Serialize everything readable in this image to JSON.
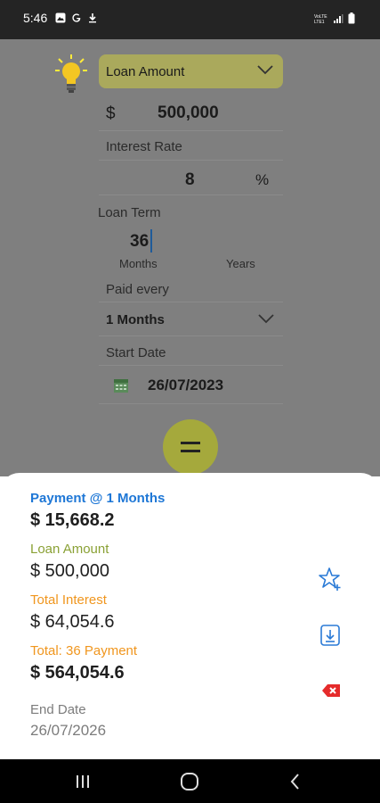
{
  "status_bar": {
    "time": "5:46",
    "left_icons": [
      "gallery-icon",
      "google-icon",
      "download-icon"
    ],
    "right_icons": [
      "volte-icon",
      "signal-icon",
      "battery-icon"
    ],
    "network_text": "VoLTE"
  },
  "form": {
    "calc_type": "Loan Amount",
    "currency_symbol": "$",
    "amount_value": "500,000",
    "interest_label": "Interest Rate",
    "interest_value": "8",
    "percent_symbol": "%",
    "term_label": "Loan Term",
    "term_value": "36",
    "term_units": [
      "Months",
      "Years"
    ],
    "paid_every_label": "Paid every",
    "paid_every_value": "1 Months",
    "start_date_label": "Start Date",
    "start_date_value": "26/07/2023",
    "equals_button": "="
  },
  "results": {
    "payment_label": "Payment @ 1 Months",
    "payment_value": "$ 15,668.2",
    "loan_amount_label": "Loan Amount",
    "loan_amount_value": "$ 500,000",
    "total_interest_label": "Total Interest",
    "total_interest_value": "$ 64,054.6",
    "total_payment_label": "Total: 36 Payment",
    "total_payment_value": "$ 564,054.6",
    "end_date_label": "End Date",
    "end_date_value": "26/07/2026"
  },
  "actions": [
    "star-add-icon",
    "save-icon",
    "delete-icon"
  ],
  "colors": {
    "blue": "#1e77d6",
    "green": "#8aa135",
    "orange": "#f0961e",
    "accent": "#a5a93c"
  },
  "navbar": [
    "recent-apps-icon",
    "home-icon",
    "back-icon"
  ]
}
